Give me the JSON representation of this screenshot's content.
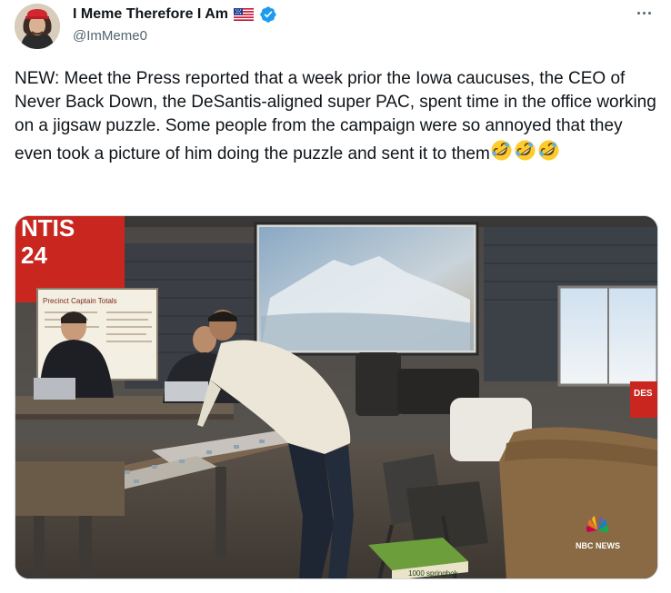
{
  "author": {
    "display_name": "I Meme Therefore I Am",
    "handle": "@ImMeme0",
    "verified": true,
    "flag": "us-flag-icon"
  },
  "tweet": {
    "text": "NEW: Meet the Press reported that a week prior the Iowa caucuses, the CEO of Never Back Down, the DeSantis-aligned super PAC, spent time in the office working on a jigsaw puzzle. Some people from the campaign were so annoyed that they even took a picture of him doing the puzzle and sent it to them",
    "emojis": [
      "rolling-on-floor-laughing",
      "rolling-on-floor-laughing",
      "rolling-on-floor-laughing"
    ]
  },
  "media": {
    "banner_text": "NTIS\n24",
    "whiteboard_heading": "Precinct Captain Totals",
    "logo_text": "NBC NEWS",
    "box_label": "1000 springbok",
    "sign_text": "DES"
  },
  "colors": {
    "text": "#0f1419",
    "secondary": "#536471",
    "verified": "#1d9bf0"
  }
}
